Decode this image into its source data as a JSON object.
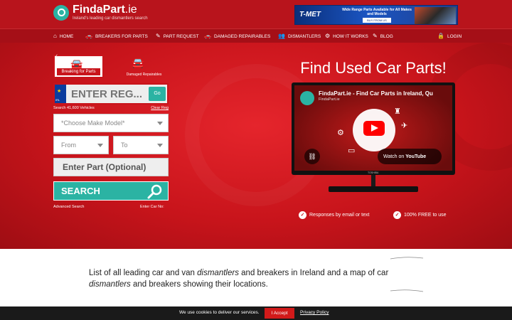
{
  "header": {
    "logo_name": "FindaPart",
    "logo_tld": ".ie",
    "logo_tagline": "Ireland's leading car dismantlers search",
    "ad": {
      "brand": "T-MET",
      "text": "Wide Range Parts Available for All Makes and Models",
      "cta": "BUY FROM US"
    }
  },
  "nav": {
    "items": [
      {
        "label": "HOME",
        "icon": "home-icon"
      },
      {
        "label": "BREAKERS FOR PARTS",
        "icon": "car-icon"
      },
      {
        "label": "PART REQUEST",
        "icon": "edit-icon"
      },
      {
        "label": "DAMAGED REPAIRABLES",
        "icon": "car-icon"
      },
      {
        "label": "DISMANTLERS",
        "icon": "users-icon"
      },
      {
        "label": "HOW IT WORKS",
        "icon": "gear-icon"
      },
      {
        "label": "BLOG",
        "icon": "edit-icon"
      }
    ],
    "login": "LOGIN"
  },
  "search": {
    "tab_active": "Breaking for Parts",
    "tab_inactive": "Damaged Repairables",
    "reg_placeholder": "ENTER REG...",
    "reg_flag_text": "IRL",
    "go_label": "Go",
    "vehicle_count": "Search 41,600 Vehicles",
    "clear_reg": "Clear Reg",
    "make_model_placeholder": "*Choose Make Model*",
    "from_placeholder": "From",
    "to_placeholder": "To",
    "part_placeholder": "Enter Part (Optional)",
    "search_label": "SEARCH",
    "advanced": "Advanced Search",
    "enter_car_no": "Enter Car No:"
  },
  "hero": {
    "title": "Find Used Car Parts!",
    "video_title": "FindaPart.ie - Find Car Parts in Ireland, Qu",
    "video_channel": "FindaPart.ie",
    "watch_on": "Watch on",
    "youtube": "YouTube",
    "tv_brand": "TOSHIBA",
    "bullets": [
      "Responses by email or text",
      "100% FREE to use"
    ]
  },
  "intro": {
    "part1": "List of all leading car and van ",
    "em1": "dismantlers",
    "part2": " and breakers in Ireland and a map of car ",
    "em2": "dismantlers",
    "part3": " and breakers showing their locations."
  },
  "cookie": {
    "message": "We use cookies to deliver our services.",
    "accept": "I Accept",
    "policy": "Privacy Policy"
  },
  "colors": {
    "brand_red": "#c8141b",
    "teal": "#2bb3a3",
    "nav_red": "#a50f17"
  }
}
